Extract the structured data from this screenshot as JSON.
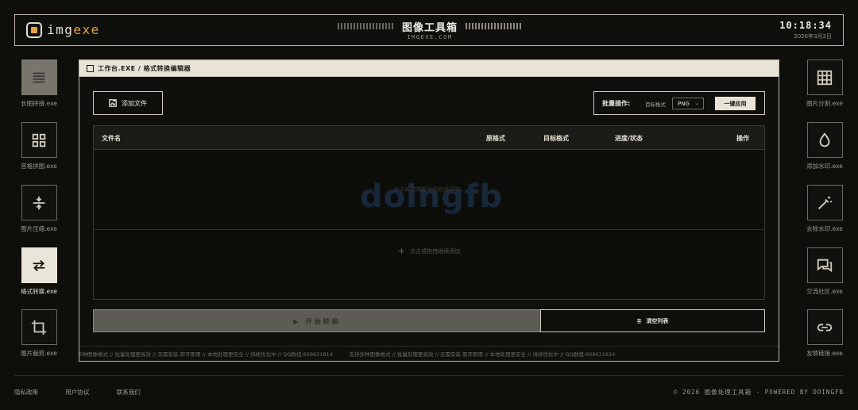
{
  "header": {
    "logo_part1": "img",
    "logo_part2": "exe",
    "title": "图像工具箱",
    "subtitle": "IMGEXE.COM",
    "time": "10:18:34",
    "date": "2026年3月2日"
  },
  "left_tools": [
    {
      "label": "长图拼接.exe",
      "icon": "lines-icon"
    },
    {
      "label": "宫格拼图.exe",
      "icon": "grid-2x2-icon"
    },
    {
      "label": "图片压缩.exe",
      "icon": "compress-icon"
    },
    {
      "label": "格式转换.exe",
      "icon": "swap-arrows-icon",
      "active": true
    },
    {
      "label": "图片裁剪.exe",
      "icon": "crop-icon"
    }
  ],
  "right_tools": [
    {
      "label": "图片分割.exe",
      "icon": "grid-3x3-icon"
    },
    {
      "label": "添加水印.exe",
      "icon": "droplet-icon"
    },
    {
      "label": "去除水印.exe",
      "icon": "magic-wand-icon"
    },
    {
      "label": "交流社区.exe",
      "icon": "chat-icon"
    },
    {
      "label": "友情链接.exe",
      "icon": "link-icon"
    }
  ],
  "window": {
    "titlebar": "工作台.EXE / 格式转换编辑器",
    "add_file": "添加文件",
    "batch": {
      "label": "批量操作:",
      "target_format_label": "目标格式",
      "selected_format": "PNG",
      "apply": "一键应用"
    },
    "table": {
      "columns": [
        "文件名",
        "原格式",
        "目标格式",
        "进度/状态",
        "操作"
      ],
      "watermark": "doingfb",
      "hint": "点击或拖拽图片到此处开始...",
      "drop_text": "点击或拖拽继续添加"
    },
    "start": "开始转换",
    "clear": "清空列表",
    "ticker": "支持多种图像格式 // 批量处理更高效 // 无需安装 即开即用 // 本地处理更安全 // 持续优化中 // QQ群组:608631814"
  },
  "footer": {
    "links": [
      "隐私政策",
      "用户协议",
      "联系我们"
    ],
    "copyright": "© 2026 图像处理工具箱 - POWERED BY DOINGFB"
  },
  "colors": {
    "accent": "#e8a33a",
    "panel_light": "#e7e4d6",
    "background": "#0e0e0b"
  }
}
